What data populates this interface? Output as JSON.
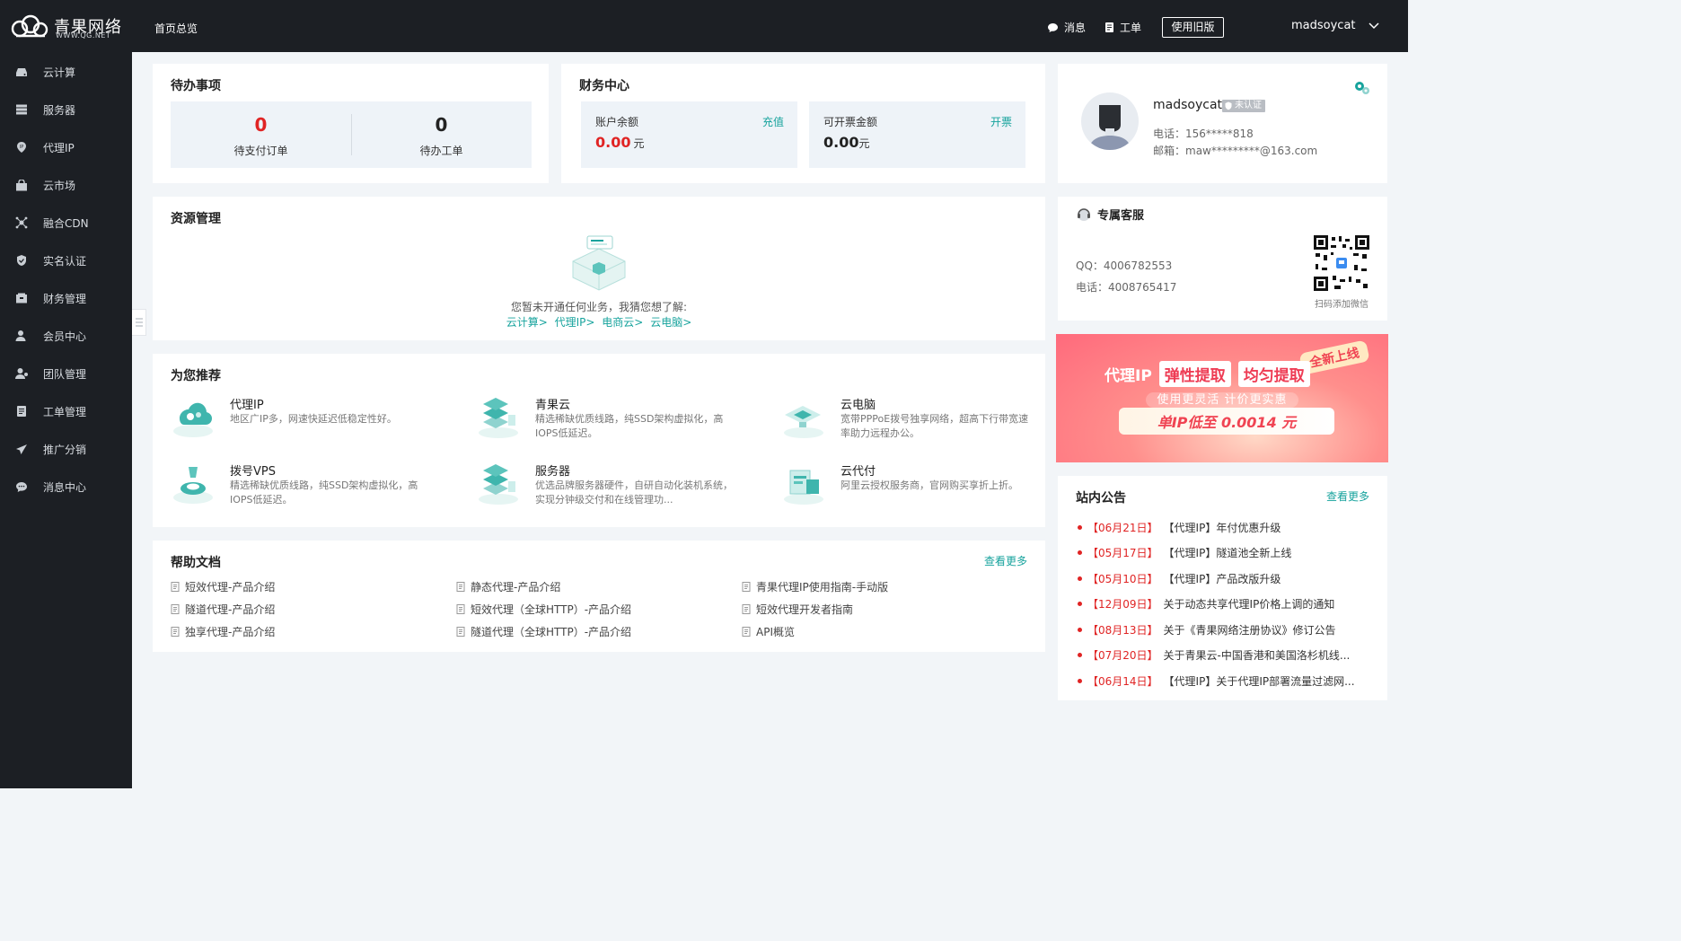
{
  "brand": {
    "name": "青果网络",
    "url": "WWW.QG.NET"
  },
  "header": {
    "breadcrumb": "首页总览",
    "messages_label": "消息",
    "tickets_label": "工单",
    "old_version_label": "使用旧版",
    "username": "madsoycat"
  },
  "sidebar": {
    "items": [
      {
        "label": "云计算",
        "icon": "cloud-drive-icon"
      },
      {
        "label": "服务器",
        "icon": "server-icon"
      },
      {
        "label": "代理IP",
        "icon": "location-pin-icon"
      },
      {
        "label": "云市场",
        "icon": "bag-icon"
      },
      {
        "label": "融合CDN",
        "icon": "network-icon"
      },
      {
        "label": "实名认证",
        "icon": "shield-check-icon"
      },
      {
        "label": "财务管理",
        "icon": "wallet-icon"
      },
      {
        "label": "会员中心",
        "icon": "member-icon"
      },
      {
        "label": "团队管理",
        "icon": "team-icon"
      },
      {
        "label": "工单管理",
        "icon": "ticket-icon"
      },
      {
        "label": "推广分销",
        "icon": "send-icon"
      },
      {
        "label": "消息中心",
        "icon": "chat-icon"
      }
    ]
  },
  "todo": {
    "title": "待办事项",
    "pending_orders": {
      "value": "0",
      "label": "待支付订单"
    },
    "pending_tickets": {
      "value": "0",
      "label": "待办工单"
    }
  },
  "finance": {
    "title": "财务中心",
    "balance": {
      "label": "账户余额",
      "value": "0.00",
      "unit": "元",
      "action": "充值"
    },
    "invoice": {
      "label": "可开票金额",
      "value": "0.00",
      "unit": "元",
      "action": "开票"
    }
  },
  "profile": {
    "username": "madsoycat",
    "verify_badge": "未认证",
    "phone": "电话：156*****818",
    "email": "邮箱：maw*********@163.com"
  },
  "resources": {
    "title": "资源管理",
    "empty_text": "您暂未开通任何业务，我猜您想了解:",
    "links": [
      "云计算>",
      "代理IP>",
      "电商云>",
      "云电脑>"
    ]
  },
  "recommend": {
    "title": "为您推荐",
    "items": [
      {
        "title": "代理IP",
        "desc": "地区广IP多，网速快延迟低稳定性好。",
        "icon": "proxy-ip-icon"
      },
      {
        "title": "青果云",
        "desc": "精选稀缺优质线路，纯SSD架构虚拟化，高IOPS低延迟。",
        "icon": "qingguo-cloud-icon"
      },
      {
        "title": "云电脑",
        "desc": "宽带PPPoE拨号独享网络，超高下行带宽速率助力远程办公。",
        "icon": "cloud-pc-icon"
      },
      {
        "title": "拨号VPS",
        "desc": "精选稀缺优质线路，纯SSD架构虚拟化，高IOPS低延迟。",
        "icon": "dial-vps-icon"
      },
      {
        "title": "服务器",
        "desc": "优选品牌服务器硬件，自研自动化装机系统，实现分钟级交付和在线管理功...",
        "icon": "server-rack-icon"
      },
      {
        "title": "云代付",
        "desc": "阿里云授权服务商，官网购买享折上折。",
        "icon": "cloud-pay-icon"
      }
    ]
  },
  "help_docs": {
    "title": "帮助文档",
    "more": "查看更多",
    "items": [
      "短效代理-产品介绍",
      "静态代理-产品介绍",
      "青果代理IP使用指南-手动版",
      "隧道代理-产品介绍",
      "短效代理（全球HTTP）-产品介绍",
      "短效代理开发者指南",
      "独享代理-产品介绍",
      "隧道代理（全球HTTP）-产品介绍",
      "API概览"
    ]
  },
  "service": {
    "title": "专属客服",
    "qq": "QQ：4006782553",
    "phone": "电话：4008765417",
    "qr_caption": "扫码添加微信"
  },
  "banner": {
    "corner": "全新上线",
    "headline": [
      "代理IP",
      "弹性提取",
      "均匀提取"
    ],
    "sub": "使用更灵活  计价更实惠",
    "price": "单IP低至 0.0014 元"
  },
  "announcements": {
    "title": "站内公告",
    "more": "查看更多",
    "items": [
      {
        "date": "【06月21日】",
        "text": "【代理IP】年付优惠升级"
      },
      {
        "date": "【05月17日】",
        "text": "【代理IP】隧道池全新上线"
      },
      {
        "date": "【05月10日】",
        "text": "【代理IP】产品改版升级"
      },
      {
        "date": "【12月09日】",
        "text": "关于动态共享代理IP价格上调的通知"
      },
      {
        "date": "【08月13日】",
        "text": "关于《青果网络注册协议》修订公告"
      },
      {
        "date": "【07月20日】",
        "text": "关于青果云-中国香港和美国洛杉机线..."
      },
      {
        "date": "【06月14日】",
        "text": "【代理IP】关于代理IP部署流量过滤网..."
      }
    ]
  },
  "colors": {
    "dark_bg": "#1c1f24",
    "page_bg": "#f2f5f8",
    "accent": "#17a39d",
    "alert_red": "#e02424"
  }
}
